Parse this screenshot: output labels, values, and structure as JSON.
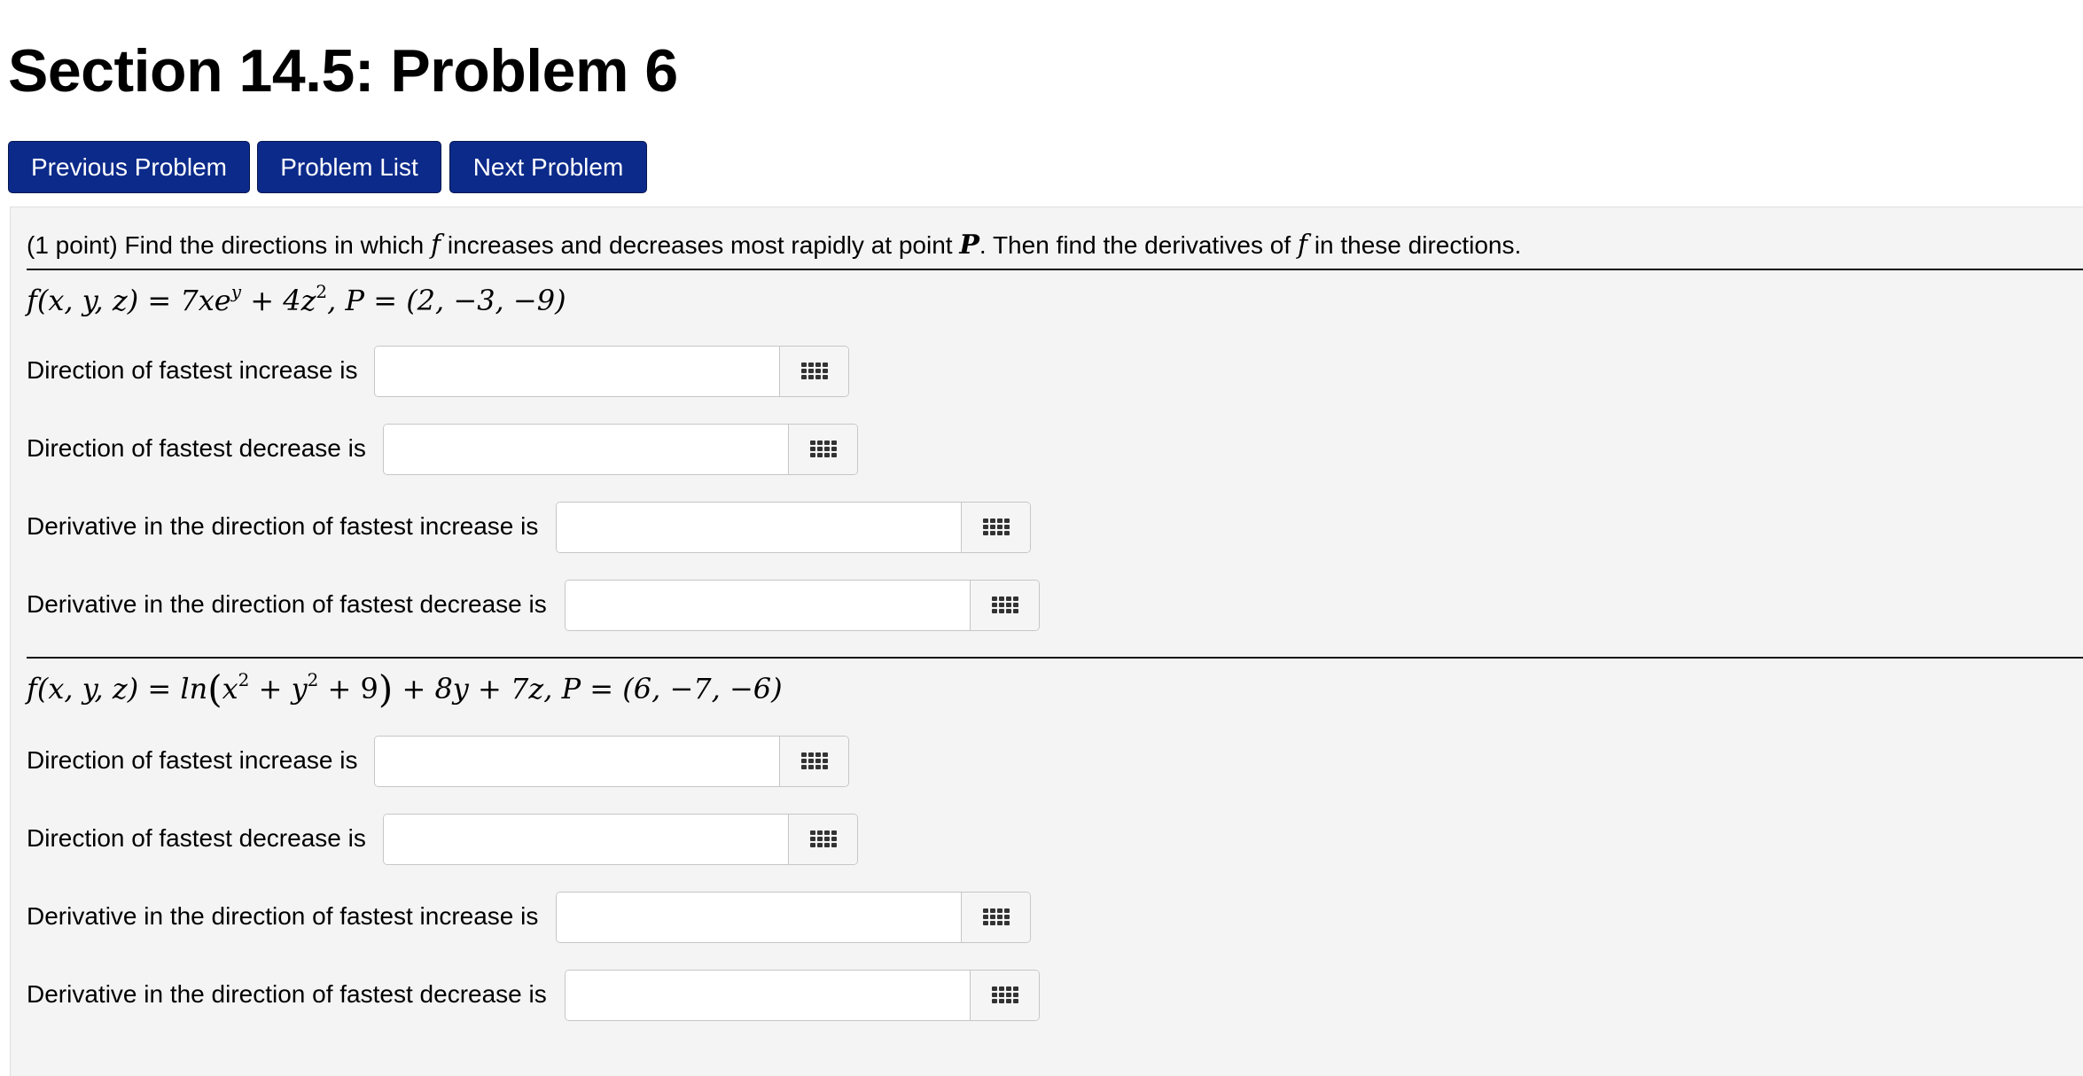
{
  "page": {
    "title": "Section 14.5: Problem 6"
  },
  "nav": {
    "previous": "Previous Problem",
    "list": "Problem List",
    "next": "Next Problem"
  },
  "problem": {
    "points": "(1 point)",
    "text_a": "Find the directions in which",
    "f": "f",
    "text_b": "increases and decreases most rapidly at point",
    "P": "P",
    "text_c": ". Then find the derivatives of",
    "text_d": "in these directions."
  },
  "part1": {
    "equation": {
      "lhs": "f(x, y, z) = 7xe",
      "exp_y": "y",
      "plus_coef": " + 4z",
      "exp_2": "2",
      "point": ",  P = (2, −3, −9)"
    },
    "labels": {
      "inc_dir": "Direction of fastest increase is",
      "dec_dir": "Direction of fastest decrease is",
      "inc_deriv": "Derivative in the direction of fastest increase is",
      "dec_deriv": "Derivative in the direction of fastest decrease is"
    },
    "answers": {
      "inc_dir": "",
      "dec_dir": "",
      "inc_deriv": "",
      "dec_deriv": ""
    }
  },
  "part2": {
    "equation": {
      "lhs": "f(x, y, z) = ln",
      "open": "(",
      "x": "x",
      "exp_x": "2",
      "plus_y": " + y",
      "exp_y": "2",
      "plus_9": " + 9",
      "close": ")",
      "rest": " + 8y + 7z,  P = (6, −7, −6)"
    },
    "labels": {
      "inc_dir": "Direction of fastest increase is",
      "dec_dir": "Direction of fastest decrease is",
      "inc_deriv": "Derivative in the direction of fastest increase is",
      "dec_deriv": "Derivative in the direction of fastest decrease is"
    },
    "answers": {
      "inc_dir": "",
      "dec_dir": "",
      "inc_deriv": "",
      "dec_deriv": ""
    }
  },
  "icons": {
    "answer_helper": "keyboard-grid-icon"
  },
  "colors": {
    "nav_button": "#0c2a8a",
    "panel_bg": "#f4f4f4"
  }
}
